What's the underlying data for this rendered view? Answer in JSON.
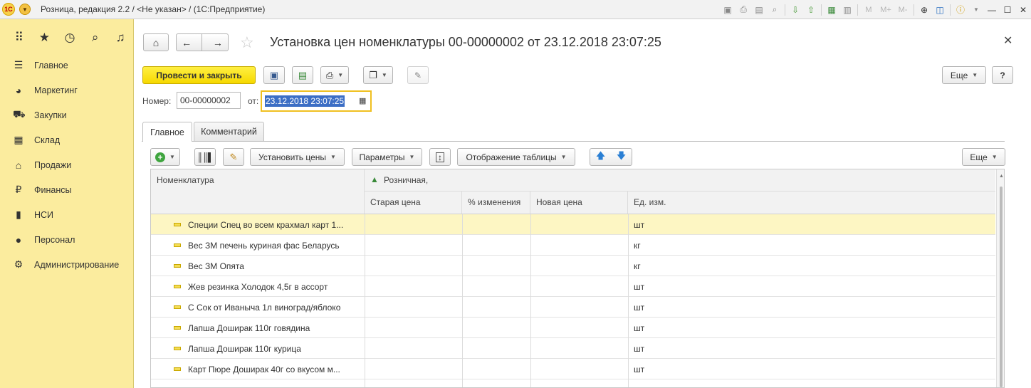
{
  "titlebar": {
    "logo": "1С",
    "title": "Розница, редакция 2.2 / <Не указан> / (1С:Предприятие)",
    "m_labels": [
      "M",
      "M+",
      "M-"
    ]
  },
  "sidebar": {
    "items": [
      {
        "label": "Главное",
        "icon": "menu-lines-icon",
        "glyph": "☰"
      },
      {
        "label": "Маркетинг",
        "icon": "pie-chart-icon",
        "glyph": "◕"
      },
      {
        "label": "Закупки",
        "icon": "cart-icon",
        "glyph": "⛟"
      },
      {
        "label": "Склад",
        "icon": "warehouse-icon",
        "glyph": "▦"
      },
      {
        "label": "Продажи",
        "icon": "basket-icon",
        "glyph": "⌂"
      },
      {
        "label": "Финансы",
        "icon": "ruble-coin-icon",
        "glyph": "₽"
      },
      {
        "label": "НСИ",
        "icon": "books-icon",
        "glyph": "▮"
      },
      {
        "label": "Персонал",
        "icon": "person-icon",
        "glyph": "●"
      },
      {
        "label": "Администрирование",
        "icon": "gear-icon",
        "glyph": "⚙"
      }
    ]
  },
  "form": {
    "title": "Установка цен номенклатуры 00-00000002 от 23.12.2018 23:07:25",
    "post_close_label": "Провести и закрыть",
    "more_label": "Еще",
    "help_label": "?",
    "number_label": "Номер:",
    "number_value": "00-00000002",
    "from_label": "от:",
    "date_value": "23.12.2018 23:07:25",
    "tabs": [
      "Главное",
      "Комментарий"
    ],
    "table_toolbar": {
      "set_prices": "Установить цены",
      "parameters": "Параметры",
      "table_display": "Отображение таблицы",
      "more": "Еще"
    },
    "columns": {
      "item": "Номенклатура",
      "price_type": "Розничная,",
      "old_price": "Старая цена",
      "change_pct": "% изменения",
      "new_price": "Новая цена",
      "unit": "Ед. изм."
    },
    "rows": [
      {
        "name": "Специи Спец во всем крахмал карт 1...",
        "unit": "шт"
      },
      {
        "name": "Вес  ЗМ печень куриная  фас Беларусь",
        "unit": "кг"
      },
      {
        "name": "Вес  ЗМ Опята",
        "unit": "кг"
      },
      {
        "name": "Жев резинка Холодок 4,5г в ассорт",
        "unit": "шт"
      },
      {
        "name": "С Сок от Иваныча 1л виноград/яблоко",
        "unit": "шт"
      },
      {
        "name": "Лапша Доширак 110г говядина",
        "unit": "шт"
      },
      {
        "name": "Лапша Доширак 110г курица",
        "unit": "шт"
      },
      {
        "name": "Карт Пюре Доширак 40г со вкусом м...",
        "unit": "шт"
      }
    ]
  }
}
